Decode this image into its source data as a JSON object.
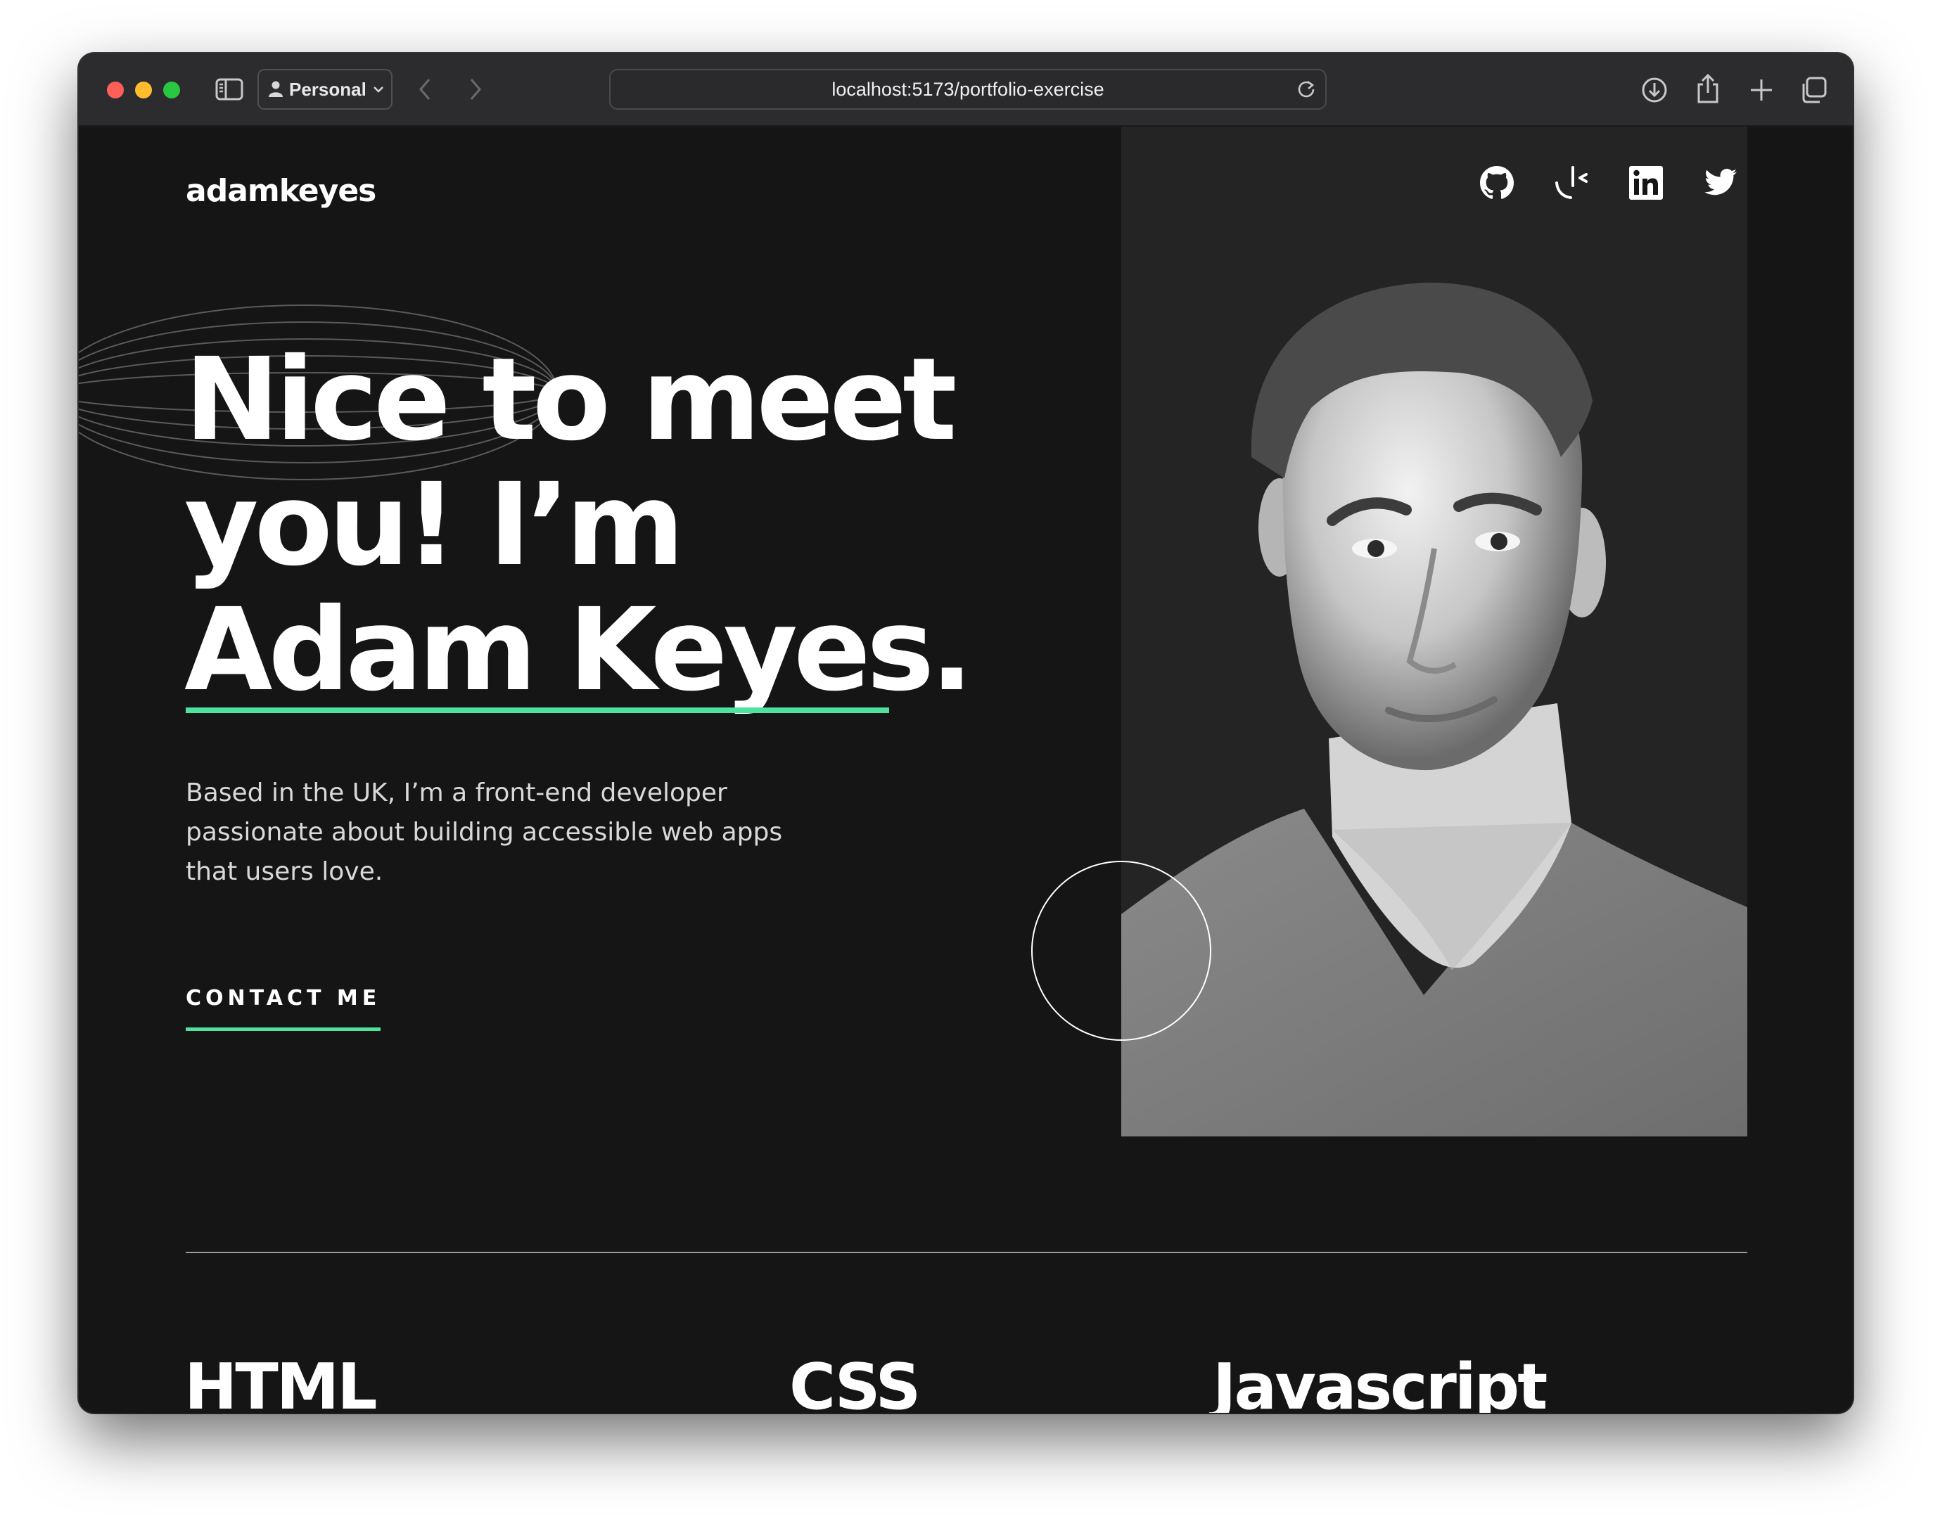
{
  "browser": {
    "profile_label": "Personal",
    "url": "localhost:5173/portfolio-exercise",
    "icons": [
      "sidebar-icon",
      "person-icon",
      "chevron-down-icon",
      "chevron-left-icon",
      "chevron-right-icon",
      "reload-icon",
      "download-icon",
      "share-icon",
      "plus-icon",
      "tabs-icon"
    ]
  },
  "header": {
    "logo": "adamkeyes",
    "socials": [
      "github-icon",
      "frontend-mentor-icon",
      "linkedin-icon",
      "twitter-icon"
    ]
  },
  "hero": {
    "headline_lines": [
      "Nice to meet",
      "you! I’m",
      "Adam Keyes."
    ],
    "intro_lines": [
      "Based in the UK, I’m a front-end developer",
      "passionate about building accessible web apps",
      "that users love."
    ],
    "cta": "CONTACT ME",
    "accent_color": "#4ee1a0"
  },
  "skills": [
    {
      "name": "HTML"
    },
    {
      "name": "CSS"
    },
    {
      "name": "Javascript"
    }
  ],
  "colors": {
    "background": "#151515",
    "panel": "#242424",
    "text": "#ffffff",
    "accent": "#4ee1a0"
  }
}
